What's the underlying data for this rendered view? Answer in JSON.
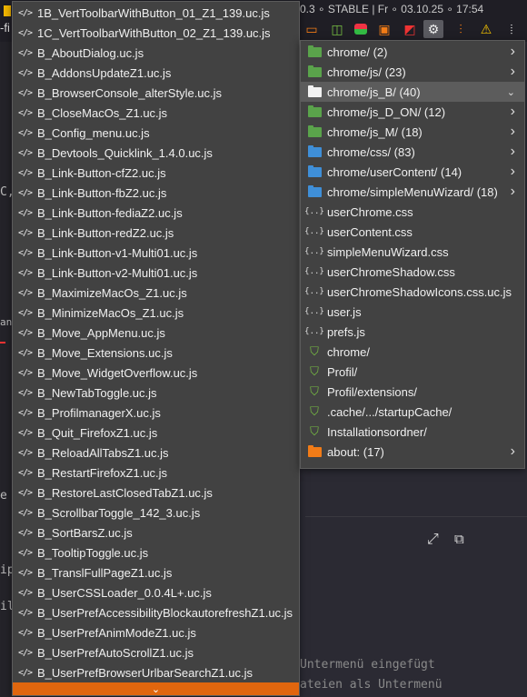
{
  "topbar": {
    "text": "0.3 ∘ STABLE | Fr ∘ 03.10.25 ∘ 17:54",
    "left_fragment": "-fi"
  },
  "toolbar_icons": [
    "message-icon",
    "sidebar-icon",
    "toggle-icon",
    "panel-icon",
    "extension-icon",
    "gear-icon",
    "sliders-icon",
    "warning-icon",
    "overflow-icon"
  ],
  "bg_left_fragments": [
    {
      "text": "C,"
    },
    {
      "text": "an"
    },
    {
      "text": "e"
    },
    {
      "text": "ip"
    },
    {
      "text": "il"
    }
  ],
  "bg_code_lines": [
    "Untermenü eingefügt",
    "ateien als Untermenü"
  ],
  "left_menu": {
    "items": [
      "1B_VertToolbarWithButton_01_Z1_139.uc.js",
      "1C_VertToolbarWithButton_02_Z1_139.uc.js",
      "B_AboutDialog.uc.js",
      "B_AddonsUpdateZ1.uc.js",
      "B_BrowserConsole_alterStyle.uc.js",
      "B_CloseMacOs_Z1.uc.js",
      "B_Config_menu.uc.js",
      "B_Devtools_Quicklink_1.4.0.uc.js",
      "B_Link-Button-cfZ2.uc.js",
      "B_Link-Button-fbZ2.uc.js",
      "B_Link-Button-fediaZ2.uc.js",
      "B_Link-Button-redZ2.uc.js",
      "B_Link-Button-v1-Multi01.uc.js",
      "B_Link-Button-v2-Multi01.uc.js",
      "B_MaximizeMacOs_Z1.uc.js",
      "B_MinimizeMacOs_Z1.uc.js",
      "B_Move_AppMenu.uc.js",
      "B_Move_Extensions.uc.js",
      "B_Move_WidgetOverflow.uc.js",
      "B_NewTabToggle.uc.js",
      "B_ProfilmanagerX.uc.js",
      "B_Quit_FirefoxZ1.uc.js",
      "B_ReloadAllTabsZ1.uc.js",
      "B_RestartFirefoxZ1.uc.js",
      "B_RestoreLastClosedTabZ1.uc.js",
      "B_ScrollbarToggle_142_3.uc.js",
      "B_SortBarsZ.uc.js",
      "B_TooltipToggle.uc.js",
      "B_TranslFullPageZ1.uc.js",
      "B_UserCSSLoader_0.0.4L+.uc.js",
      "B_UserPrefAccessibilityBlockautorefreshZ1.uc.js",
      "B_UserPrefAnimModeZ1.uc.js",
      "B_UserPrefAutoScrollZ1.uc.js",
      "B_UserPrefBrowserUrlbarSearchZ1.uc.js"
    ],
    "item_icon": "</>",
    "scroll_down_glyph": "⌄"
  },
  "right_menu": {
    "items": [
      {
        "label": "chrome/ (2)",
        "icon": "folder-green",
        "submenu": true
      },
      {
        "label": "chrome/js/ (23)",
        "icon": "folder-green",
        "submenu": true
      },
      {
        "label": "chrome/js_B/ (40)",
        "icon": "folder-white",
        "submenu": true,
        "highlighted": true,
        "expanded": true
      },
      {
        "label": "chrome/js_D_ON/ (12)",
        "icon": "folder-green",
        "submenu": true
      },
      {
        "label": "chrome/js_M/ (18)",
        "icon": "folder-green",
        "submenu": true
      },
      {
        "label": "chrome/css/ (83)",
        "icon": "folder-blue",
        "submenu": true
      },
      {
        "label": "chrome/userContent/ (14)",
        "icon": "folder-blue",
        "submenu": true
      },
      {
        "label": "chrome/simpleMenuWizard/ (18)",
        "icon": "folder-blue",
        "submenu": true
      },
      {
        "label": "userChrome.css",
        "icon": "css"
      },
      {
        "label": "userContent.css",
        "icon": "css"
      },
      {
        "label": "simpleMenuWizard.css",
        "icon": "css"
      },
      {
        "label": "userChromeShadow.css",
        "icon": "css"
      },
      {
        "label": "userChromeShadowIcons.css.uc.js",
        "icon": "css"
      },
      {
        "label": "user.js",
        "icon": "css"
      },
      {
        "label": "prefs.js",
        "icon": "css"
      },
      {
        "label": "chrome/",
        "icon": "fx"
      },
      {
        "label": "Profil/",
        "icon": "fx"
      },
      {
        "label": "Profil/extensions/",
        "icon": "fx"
      },
      {
        "label": ".cache/.../startupCache/",
        "icon": "fx"
      },
      {
        "label": "Installationsordner/",
        "icon": "fx"
      },
      {
        "label": "about: (17)",
        "icon": "folder-orange",
        "submenu": true
      }
    ],
    "css_icon_text": "{..}",
    "fx_icon_glyph": "⛉",
    "submenu_arrow": "›",
    "expanded_arrow": "⌄"
  },
  "colors": {
    "accent": "#e0660e",
    "menu_bg": "#424242",
    "highlight": "#5c5c5c"
  }
}
